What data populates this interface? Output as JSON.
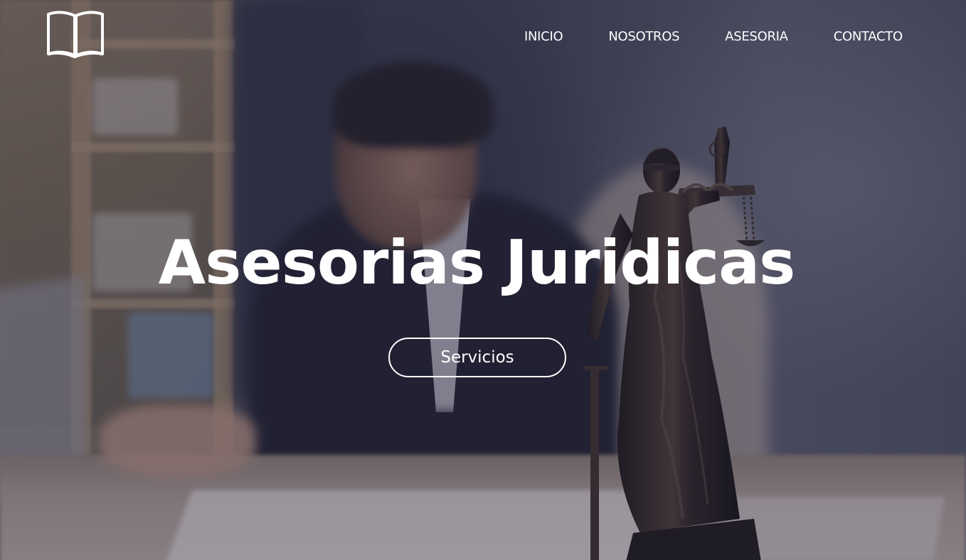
{
  "nav": {
    "items": [
      {
        "label": "INICIO"
      },
      {
        "label": "NOSOTROS"
      },
      {
        "label": "ASESORIA"
      },
      {
        "label": "CONTACTO"
      }
    ]
  },
  "logo": {
    "icon": "open-book-icon"
  },
  "hero": {
    "title": "Asesorias Juridicas",
    "cta_label": "Servicios",
    "background_image": "lawyer-at-desk-with-lady-justice-statue"
  },
  "colors": {
    "text": "#ffffff",
    "overlay": "#2a2a46"
  }
}
